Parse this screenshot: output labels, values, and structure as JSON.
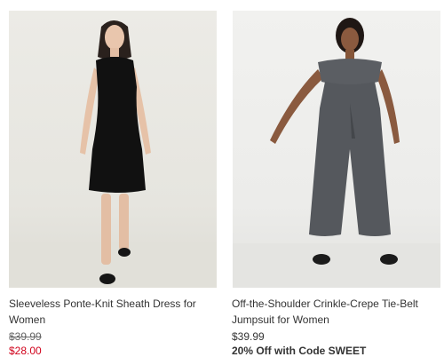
{
  "products": [
    {
      "image_alt": "Sleeveless Ponte-Knit Sheath Dress",
      "title": "Sleeveless Ponte-Knit Sheath Dress for Women",
      "original_price": "$39.99",
      "sale_price": "$28.00"
    },
    {
      "image_alt": "Off-the-Shoulder Crinkle-Crepe Tie-Belt Jumpsuit",
      "title": "Off-the-Shoulder Crinkle-Crepe Tie-Belt Jumpsuit for Women",
      "price": "$39.99",
      "promo": "20% Off with Code SWEET"
    }
  ],
  "colors": {
    "sale_price": "#d0021b",
    "text": "#333333",
    "struck_price": "#666666"
  }
}
